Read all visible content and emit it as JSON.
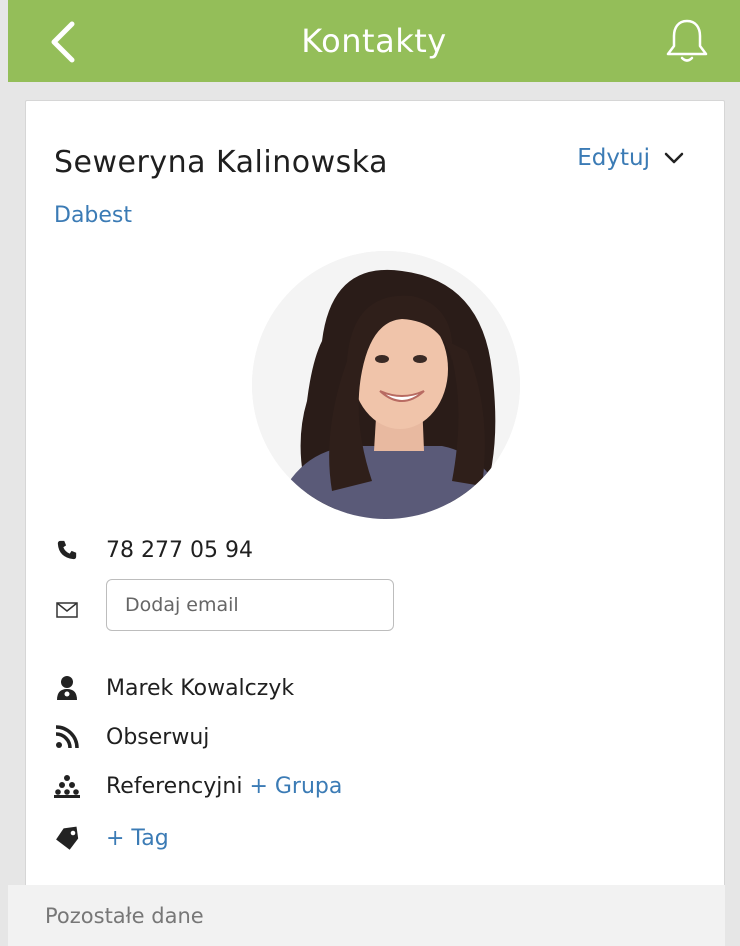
{
  "header": {
    "title": "Kontakty",
    "background": "#94be59",
    "back_icon": "chevron-left-icon",
    "bell_icon": "bell-icon"
  },
  "contact": {
    "name": "Seweryna Kalinowska",
    "edit_label": "Edytuj",
    "company": "Dabest",
    "avatar": "profile-photo",
    "phone": "78 277 05 94",
    "email_placeholder": "Dodaj email",
    "owner": "Marek Kowalczyk",
    "follow_label": "Obserwuj",
    "group_label": "Referencyjni",
    "add_group_label": "+ Grupa",
    "add_tag_label": "+ Tag"
  },
  "section": {
    "more_label": "Pozostałe dane"
  },
  "colors": {
    "accent": "#94be59",
    "link": "#3b7bb5"
  }
}
